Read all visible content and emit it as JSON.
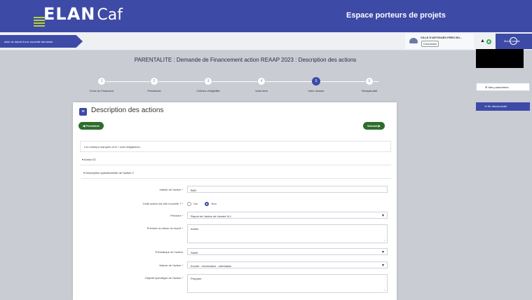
{
  "header": {
    "brand": "ELAN",
    "brand_suffix": "Caf",
    "espace": "Espace porteurs de projets"
  },
  "subbar": {
    "tab_label": "aisie de dépôt d'une nouvelle demande",
    "org_name": "VILLE D'ARTIGUES PRES BO...",
    "org_button": "Connexion",
    "user_menu": "Mon Compte",
    "params_label": "Mes paramètres",
    "logout_label": "Se déconnecter"
  },
  "page": {
    "title": "PARENTALITE : Demande de Financement action REAAP 2023 : Description des actions"
  },
  "steps": [
    {
      "num": "1",
      "label": "Choix du Financeur",
      "active": false
    },
    {
      "num": "2",
      "label": "Préambule",
      "active": false
    },
    {
      "num": "3",
      "label": "Critères d'éligibilité",
      "active": false
    },
    {
      "num": "4",
      "label": "Votre tiers",
      "active": false
    },
    {
      "num": "5",
      "label": "Votre dossier",
      "active": true
    },
    {
      "num": "6",
      "label": "Récapitulatif",
      "active": false
    }
  ],
  "panel": {
    "title": "Description des actions",
    "prev_label": "◀ Précédent",
    "next_label": "Suivant ▶",
    "note": "Les champs marqués d'un * sont obligatoires.",
    "accordion_action": "Action 02",
    "accordion_desc": "Description opérationnelle de l'action 2",
    "form": {
      "intitule_label": "Intitulé de l'action *",
      "intitule_value": "BAD",
      "nouvelle_label": "Cette action est-elle nouvelle ? *",
      "radio_oui": "Oui",
      "radio_non": "Non",
      "precisez_label": "Précisez *",
      "precisez_value": "Report de l'action de l'année N-1",
      "raison_label": "Précisez la raison du report *",
      "raison_value": "Amies",
      "thematique_label": "Thématique de l'action",
      "thematique_value": "Santé",
      "nature_label": "Nature de l'action *",
      "nature_value": "Ecoute - Information - orientation",
      "objectif_label": "Objectif spécifique de l'action *",
      "objectif_value": "Préparer"
    }
  }
}
